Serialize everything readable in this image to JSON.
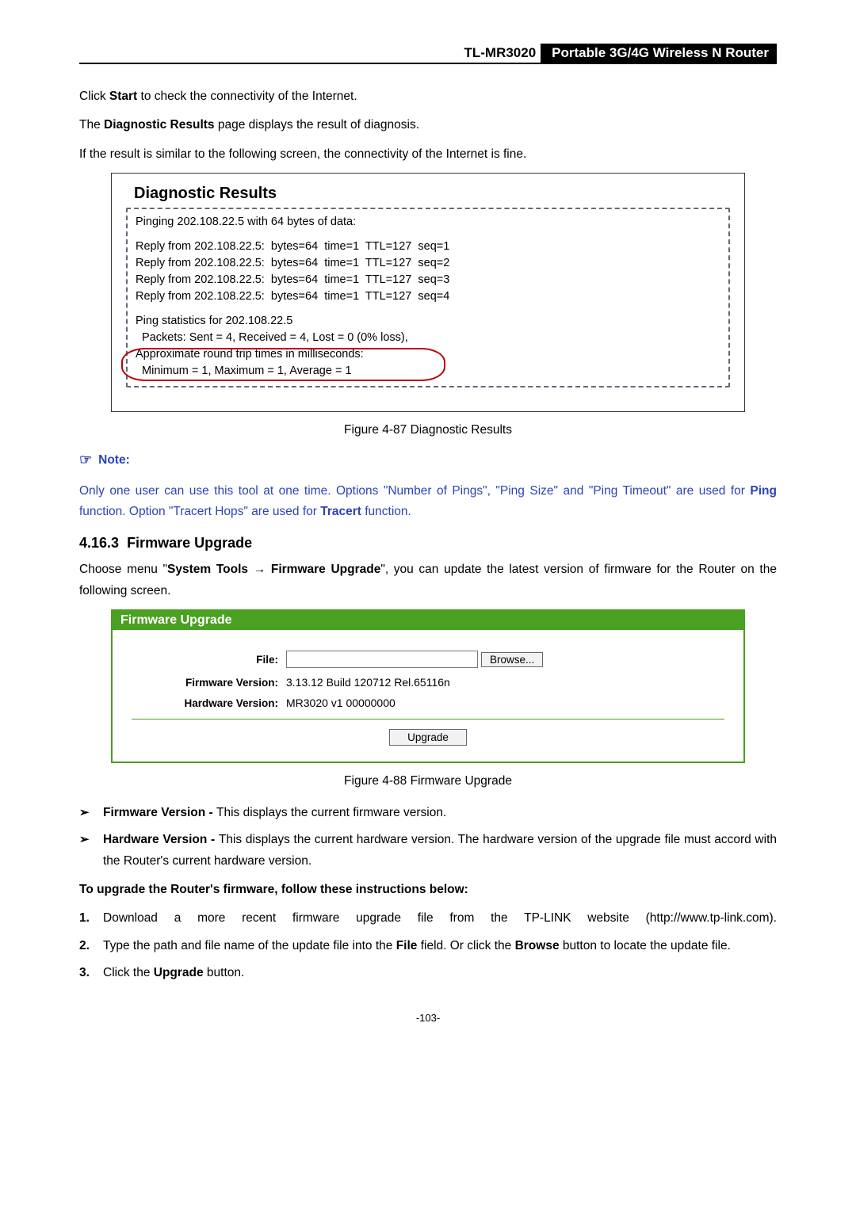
{
  "header": {
    "model": "TL-MR3020",
    "product": "Portable 3G/4G Wireless N Router"
  },
  "intro": {
    "p1_pre": "Click ",
    "p1_bold": "Start",
    "p1_post": " to check the connectivity of the Internet.",
    "p2_pre": "The ",
    "p2_bold": "Diagnostic Results",
    "p2_post": " page displays the result of diagnosis.",
    "p3": "If the result is similar to the following screen, the connectivity of the Internet is fine."
  },
  "diag": {
    "title": "Diagnostic Results",
    "lines": {
      "l0": "Pinging 202.108.22.5 with 64 bytes of data:",
      "l1": "Reply from 202.108.22.5:  bytes=64  time=1  TTL=127  seq=1",
      "l2": "Reply from 202.108.22.5:  bytes=64  time=1  TTL=127  seq=2",
      "l3": "Reply from 202.108.22.5:  bytes=64  time=1  TTL=127  seq=3",
      "l4": "Reply from 202.108.22.5:  bytes=64  time=1  TTL=127  seq=4",
      "l5": "Ping statistics for 202.108.22.5",
      "l6": "  Packets: Sent = 4, Received = 4, Lost = 0 (0% loss),",
      "l7": "Approximate round trip times in milliseconds:",
      "l8": "  Minimum = 1, Maximum = 1, Average = 1"
    },
    "caption": "Figure 4-87    Diagnostic Results"
  },
  "note": {
    "heading": "Note:",
    "body_a": "Only one user can use this tool at one time. Options \"Number of Pings\", \"Ping Size\" and \"Ping Timeout\" are used for ",
    "body_b": "Ping",
    "body_c": " function. Option \"Tracert Hops\" are used for ",
    "body_d": "Tracert",
    "body_e": " function."
  },
  "firmware": {
    "section_num": "4.16.3",
    "section_title": "Firmware Upgrade",
    "para_a": "Choose menu \"",
    "para_b": "System Tools",
    "para_arrow": " → ",
    "para_c": "Firmware Upgrade",
    "para_d": "\", you can update the latest version of firmware for the Router on the following screen.",
    "panel_title": "Firmware Upgrade",
    "file_label": "File:",
    "file_value": "",
    "browse": "Browse...",
    "fv_label": "Firmware Version:",
    "fv_value": "3.13.12 Build 120712 Rel.65116n",
    "hv_label": "Hardware Version:",
    "hv_value": "MR3020 v1 00000000",
    "upgrade": "Upgrade",
    "caption": "Figure 4-88    Firmware Upgrade"
  },
  "bullets": {
    "b1_a": "Firmware Version - ",
    "b1_b": "This displays the current firmware version.",
    "b2_a": "Hardware Version - ",
    "b2_b": "This displays the current hardware version. The hardware version of the upgrade file must accord with the Router's current hardware version."
  },
  "upgrade_instr": {
    "heading": "To upgrade the Router's firmware, follow these instructions below:",
    "s1": "Download a more recent firmware upgrade file from the TP-LINK website (http://www.tp-link.com).",
    "s2_a": "Type the path and file name of the update file into the ",
    "s2_b": "File",
    "s2_c": " field. Or click the ",
    "s2_d": "Browse",
    "s2_e": " button to locate the update file.",
    "s3_a": "Click the ",
    "s3_b": "Upgrade",
    "s3_c": " button."
  },
  "page_number": "-103-"
}
